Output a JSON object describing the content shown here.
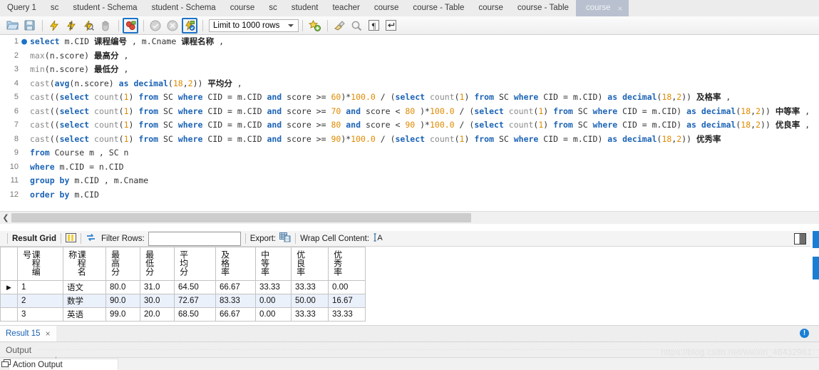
{
  "window": {
    "editor_tabs": [
      {
        "label": "Query 1",
        "active": false
      },
      {
        "label": "sc",
        "active": false
      },
      {
        "label": "student - Schema",
        "active": false
      },
      {
        "label": "student - Schema",
        "active": false
      },
      {
        "label": "course",
        "active": false
      },
      {
        "label": "sc",
        "active": false
      },
      {
        "label": "student",
        "active": false
      },
      {
        "label": "teacher",
        "active": false
      },
      {
        "label": "course",
        "active": false
      },
      {
        "label": "course - Table",
        "active": false
      },
      {
        "label": "course",
        "active": false
      },
      {
        "label": "course - Table",
        "active": false
      },
      {
        "label": "course",
        "active": true,
        "close": "×"
      }
    ]
  },
  "toolbar": {
    "icons": [
      {
        "name": "open-sql-file-icon",
        "selected": false
      },
      {
        "name": "save-sql-file-icon",
        "selected": false
      },
      {
        "name": "execute-statement-icon",
        "selected": false
      },
      {
        "name": "execute-current-statement-icon",
        "selected": false
      },
      {
        "name": "explain-statement-icon",
        "selected": false
      },
      {
        "name": "stop-execution-icon",
        "selected": false
      },
      {
        "name": "toggle-stop-on-error-icon",
        "selected": true
      },
      {
        "name": "commit-transaction-icon",
        "selected": false
      },
      {
        "name": "rollback-transaction-icon",
        "selected": false
      },
      {
        "name": "toggle-autocommit-icon",
        "selected": true
      }
    ],
    "limit_select": {
      "label": "Limit to 1000 rows",
      "caret": "▾"
    },
    "right_icons": [
      {
        "name": "save-snippet-icon"
      },
      {
        "name": "beautify-query-icon"
      },
      {
        "name": "find-icon"
      },
      {
        "name": "toggle-invisible-characters-icon",
        "glyph": "¶"
      },
      {
        "name": "toggle-word-wrap-icon",
        "glyph": "↲"
      }
    ]
  },
  "editor": {
    "breakpoint_glyph": "●",
    "lines": [
      {
        "no": "1",
        "marker": true,
        "tokens": [
          {
            "t": "select ",
            "c": "kw"
          },
          {
            "t": "m.CID ",
            "c": "pl"
          },
          {
            "t": "课程编号",
            "c": "cn"
          },
          {
            "t": " , m.Cname ",
            "c": "pl"
          },
          {
            "t": "课程名称",
            "c": "cn"
          },
          {
            "t": " ,",
            "c": "pl"
          }
        ]
      },
      {
        "no": "2",
        "marker": false,
        "tokens": [
          {
            "t": "max",
            "c": "fn"
          },
          {
            "t": "(n.score) ",
            "c": "pl"
          },
          {
            "t": "最高分",
            "c": "cn"
          },
          {
            "t": " ,",
            "c": "pl"
          }
        ]
      },
      {
        "no": "3",
        "marker": false,
        "tokens": [
          {
            "t": "min",
            "c": "fn"
          },
          {
            "t": "(n.score) ",
            "c": "pl"
          },
          {
            "t": "最低分",
            "c": "cn"
          },
          {
            "t": " ,",
            "c": "pl"
          }
        ]
      },
      {
        "no": "4",
        "marker": false,
        "tokens": [
          {
            "t": "cast",
            "c": "fn"
          },
          {
            "t": "(",
            "c": "pl"
          },
          {
            "t": "avg",
            "c": "kw"
          },
          {
            "t": "(n.score) ",
            "c": "pl"
          },
          {
            "t": "as ",
            "c": "kw"
          },
          {
            "t": "decimal",
            "c": "kw"
          },
          {
            "t": "(",
            "c": "pl"
          },
          {
            "t": "18",
            "c": "num"
          },
          {
            "t": ",",
            "c": "pl"
          },
          {
            "t": "2",
            "c": "num"
          },
          {
            "t": ")) ",
            "c": "pl"
          },
          {
            "t": "平均分",
            "c": "cn"
          },
          {
            "t": " ,",
            "c": "pl"
          }
        ]
      },
      {
        "no": "5",
        "marker": false,
        "tokens": [
          {
            "t": "cast",
            "c": "fn"
          },
          {
            "t": "((",
            "c": "pl"
          },
          {
            "t": "select ",
            "c": "kw"
          },
          {
            "t": "count",
            "c": "fn"
          },
          {
            "t": "(",
            "c": "pl"
          },
          {
            "t": "1",
            "c": "num"
          },
          {
            "t": ") ",
            "c": "pl"
          },
          {
            "t": "from ",
            "c": "kw"
          },
          {
            "t": "SC ",
            "c": "pl"
          },
          {
            "t": "where ",
            "c": "kw"
          },
          {
            "t": "CID = m.CID ",
            "c": "pl"
          },
          {
            "t": "and ",
            "c": "kw"
          },
          {
            "t": "score >= ",
            "c": "pl"
          },
          {
            "t": "60",
            "c": "num"
          },
          {
            "t": ")*",
            "c": "pl"
          },
          {
            "t": "100.0",
            "c": "num"
          },
          {
            "t": " / (",
            "c": "pl"
          },
          {
            "t": "select ",
            "c": "kw"
          },
          {
            "t": "count",
            "c": "fn"
          },
          {
            "t": "(",
            "c": "pl"
          },
          {
            "t": "1",
            "c": "num"
          },
          {
            "t": ") ",
            "c": "pl"
          },
          {
            "t": "from ",
            "c": "kw"
          },
          {
            "t": "SC ",
            "c": "pl"
          },
          {
            "t": "where ",
            "c": "kw"
          },
          {
            "t": "CID = m.CID) ",
            "c": "pl"
          },
          {
            "t": "as ",
            "c": "kw"
          },
          {
            "t": "decimal",
            "c": "kw"
          },
          {
            "t": "(",
            "c": "pl"
          },
          {
            "t": "18",
            "c": "num"
          },
          {
            "t": ",",
            "c": "pl"
          },
          {
            "t": "2",
            "c": "num"
          },
          {
            "t": ")) ",
            "c": "pl"
          },
          {
            "t": "及格率",
            "c": "cn"
          },
          {
            "t": " ,",
            "c": "pl"
          }
        ]
      },
      {
        "no": "6",
        "marker": false,
        "tokens": [
          {
            "t": "cast",
            "c": "fn"
          },
          {
            "t": "((",
            "c": "pl"
          },
          {
            "t": "select ",
            "c": "kw"
          },
          {
            "t": "count",
            "c": "fn"
          },
          {
            "t": "(",
            "c": "pl"
          },
          {
            "t": "1",
            "c": "num"
          },
          {
            "t": ") ",
            "c": "pl"
          },
          {
            "t": "from ",
            "c": "kw"
          },
          {
            "t": "SC ",
            "c": "pl"
          },
          {
            "t": "where ",
            "c": "kw"
          },
          {
            "t": "CID = m.CID ",
            "c": "pl"
          },
          {
            "t": "and ",
            "c": "kw"
          },
          {
            "t": "score >= ",
            "c": "pl"
          },
          {
            "t": "70",
            "c": "num"
          },
          {
            "t": " ",
            "c": "pl"
          },
          {
            "t": "and ",
            "c": "kw"
          },
          {
            "t": "score < ",
            "c": "pl"
          },
          {
            "t": "80",
            "c": "num"
          },
          {
            "t": " )*",
            "c": "pl"
          },
          {
            "t": "100.0",
            "c": "num"
          },
          {
            "t": " / (",
            "c": "pl"
          },
          {
            "t": "select ",
            "c": "kw"
          },
          {
            "t": "count",
            "c": "fn"
          },
          {
            "t": "(",
            "c": "pl"
          },
          {
            "t": "1",
            "c": "num"
          },
          {
            "t": ") ",
            "c": "pl"
          },
          {
            "t": "from ",
            "c": "kw"
          },
          {
            "t": "SC ",
            "c": "pl"
          },
          {
            "t": "where ",
            "c": "kw"
          },
          {
            "t": "CID = m.CID) ",
            "c": "pl"
          },
          {
            "t": "as ",
            "c": "kw"
          },
          {
            "t": "decimal",
            "c": "kw"
          },
          {
            "t": "(",
            "c": "pl"
          },
          {
            "t": "18",
            "c": "num"
          },
          {
            "t": ",",
            "c": "pl"
          },
          {
            "t": "2",
            "c": "num"
          },
          {
            "t": ")) ",
            "c": "pl"
          },
          {
            "t": "中等率",
            "c": "cn"
          },
          {
            "t": " ,",
            "c": "pl"
          }
        ]
      },
      {
        "no": "7",
        "marker": false,
        "tokens": [
          {
            "t": "cast",
            "c": "fn"
          },
          {
            "t": "((",
            "c": "pl"
          },
          {
            "t": "select ",
            "c": "kw"
          },
          {
            "t": "count",
            "c": "fn"
          },
          {
            "t": "(",
            "c": "pl"
          },
          {
            "t": "1",
            "c": "num"
          },
          {
            "t": ") ",
            "c": "pl"
          },
          {
            "t": "from ",
            "c": "kw"
          },
          {
            "t": "SC ",
            "c": "pl"
          },
          {
            "t": "where ",
            "c": "kw"
          },
          {
            "t": "CID = m.CID ",
            "c": "pl"
          },
          {
            "t": "and ",
            "c": "kw"
          },
          {
            "t": "score >= ",
            "c": "pl"
          },
          {
            "t": "80",
            "c": "num"
          },
          {
            "t": " ",
            "c": "pl"
          },
          {
            "t": "and ",
            "c": "kw"
          },
          {
            "t": "score < ",
            "c": "pl"
          },
          {
            "t": "90",
            "c": "num"
          },
          {
            "t": " )*",
            "c": "pl"
          },
          {
            "t": "100.0",
            "c": "num"
          },
          {
            "t": " / (",
            "c": "pl"
          },
          {
            "t": "select ",
            "c": "kw"
          },
          {
            "t": "count",
            "c": "fn"
          },
          {
            "t": "(",
            "c": "pl"
          },
          {
            "t": "1",
            "c": "num"
          },
          {
            "t": ") ",
            "c": "pl"
          },
          {
            "t": "from ",
            "c": "kw"
          },
          {
            "t": "SC ",
            "c": "pl"
          },
          {
            "t": "where ",
            "c": "kw"
          },
          {
            "t": "CID = m.CID) ",
            "c": "pl"
          },
          {
            "t": "as ",
            "c": "kw"
          },
          {
            "t": "decimal",
            "c": "kw"
          },
          {
            "t": "(",
            "c": "pl"
          },
          {
            "t": "18",
            "c": "num"
          },
          {
            "t": ",",
            "c": "pl"
          },
          {
            "t": "2",
            "c": "num"
          },
          {
            "t": ")) ",
            "c": "pl"
          },
          {
            "t": "优良率",
            "c": "cn"
          },
          {
            "t": " ,",
            "c": "pl"
          }
        ]
      },
      {
        "no": "8",
        "marker": false,
        "tokens": [
          {
            "t": "cast",
            "c": "fn"
          },
          {
            "t": "((",
            "c": "pl"
          },
          {
            "t": "select ",
            "c": "kw"
          },
          {
            "t": "count",
            "c": "fn"
          },
          {
            "t": "(",
            "c": "pl"
          },
          {
            "t": "1",
            "c": "num"
          },
          {
            "t": ") ",
            "c": "pl"
          },
          {
            "t": "from ",
            "c": "kw"
          },
          {
            "t": "SC ",
            "c": "pl"
          },
          {
            "t": "where ",
            "c": "kw"
          },
          {
            "t": "CID = m.CID ",
            "c": "pl"
          },
          {
            "t": "and ",
            "c": "kw"
          },
          {
            "t": "score >= ",
            "c": "pl"
          },
          {
            "t": "90",
            "c": "num"
          },
          {
            "t": ")*",
            "c": "pl"
          },
          {
            "t": "100.0",
            "c": "num"
          },
          {
            "t": " / (",
            "c": "pl"
          },
          {
            "t": "select ",
            "c": "kw"
          },
          {
            "t": "count",
            "c": "fn"
          },
          {
            "t": "(",
            "c": "pl"
          },
          {
            "t": "1",
            "c": "num"
          },
          {
            "t": ") ",
            "c": "pl"
          },
          {
            "t": "from ",
            "c": "kw"
          },
          {
            "t": "SC ",
            "c": "pl"
          },
          {
            "t": "where ",
            "c": "kw"
          },
          {
            "t": "CID = m.CID) ",
            "c": "pl"
          },
          {
            "t": "as ",
            "c": "kw"
          },
          {
            "t": "decimal",
            "c": "kw"
          },
          {
            "t": "(",
            "c": "pl"
          },
          {
            "t": "18",
            "c": "num"
          },
          {
            "t": ",",
            "c": "pl"
          },
          {
            "t": "2",
            "c": "num"
          },
          {
            "t": ")) ",
            "c": "pl"
          },
          {
            "t": "优秀率",
            "c": "cn"
          }
        ]
      },
      {
        "no": "9",
        "marker": false,
        "tokens": [
          {
            "t": "from ",
            "c": "kw"
          },
          {
            "t": "Course m , SC n",
            "c": "pl"
          }
        ]
      },
      {
        "no": "10",
        "marker": false,
        "tokens": [
          {
            "t": "where ",
            "c": "kw"
          },
          {
            "t": "m.CID = n.CID",
            "c": "pl"
          }
        ]
      },
      {
        "no": "11",
        "marker": false,
        "tokens": [
          {
            "t": "group by ",
            "c": "kw"
          },
          {
            "t": "m.CID , m.Cname",
            "c": "pl"
          }
        ]
      },
      {
        "no": "12",
        "marker": false,
        "tokens": [
          {
            "t": "order by ",
            "c": "kw"
          },
          {
            "t": "m.CID",
            "c": "pl"
          }
        ]
      }
    ]
  },
  "result_toolbar": {
    "result_grid_label": "Result Grid",
    "grid_view_icon": "grid-view-icon",
    "refresh_icon": "refresh-icon",
    "filter_label": "Filter Rows:",
    "filter_value": "",
    "filter_placeholder": "",
    "export_label": "Export:",
    "export_icon": "export-recordset-icon",
    "wrap_label": "Wrap Cell Content:",
    "wrap_icon": "wrap-cell-content-icon"
  },
  "result_grid": {
    "row_marker": "▶",
    "columns": [
      "课程编号",
      "课程名称",
      "最高分",
      "最低分",
      "平均分",
      "及格率",
      "中等率",
      "优良率",
      "优秀率"
    ],
    "rows": [
      {
        "marker": true,
        "cells": [
          "1",
          "语文",
          "80.0",
          "31.0",
          "64.50",
          "66.67",
          "33.33",
          "33.33",
          "0.00"
        ]
      },
      {
        "marker": false,
        "cells": [
          "2",
          "数学",
          "90.0",
          "30.0",
          "72.67",
          "83.33",
          "0.00",
          "50.00",
          "16.67"
        ]
      },
      {
        "marker": false,
        "cells": [
          "3",
          "英语",
          "99.0",
          "20.0",
          "68.50",
          "66.67",
          "0.00",
          "33.33",
          "33.33"
        ]
      }
    ]
  },
  "result_tabs": {
    "tabs": [
      {
        "label": "Result 15",
        "close": "×"
      }
    ],
    "status_icon": "info-badge-icon",
    "status_glyph": "!"
  },
  "output": {
    "title": "Output",
    "action_output_label": "Action Output",
    "action_output_icon": "action-output-icon"
  },
  "watermark": {
    "text": "https://blog.csdn.net/weixin_46432961"
  },
  "colors": {
    "accent": "#1a7fd4",
    "keyword": "#1b63b5",
    "number": "#e08a00",
    "function": "#8a8a8a",
    "active_tab": "#b9c0cf",
    "alt_row": "#eaf1fb"
  }
}
